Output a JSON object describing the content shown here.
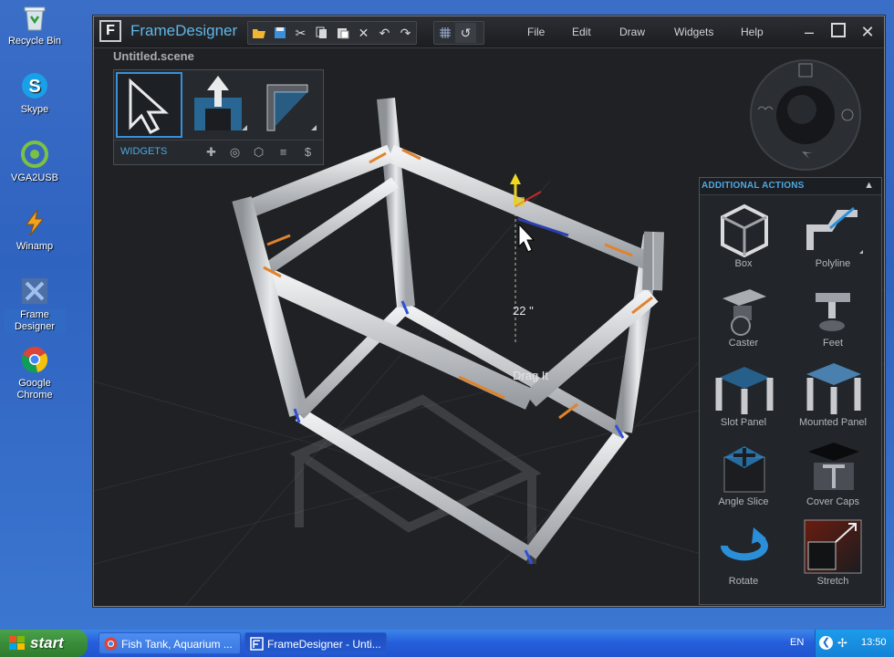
{
  "desktop": {
    "icons": [
      {
        "label": "Recycle Bin"
      },
      {
        "label": "Skype"
      },
      {
        "label": "VGA2USB"
      },
      {
        "label": "Winamp"
      },
      {
        "label": "Frame Designer"
      },
      {
        "label": "Google Chrome"
      }
    ]
  },
  "app": {
    "title": "FrameDesigner",
    "logo_letter": "F",
    "scene_name": "Untitled.scene",
    "menu": [
      "File",
      "Edit",
      "Draw",
      "Widgets",
      "Help"
    ],
    "toolbar_icons": [
      "folder-open-icon",
      "save-icon",
      "cut-icon",
      "copy-icon",
      "paste-icon",
      "delete-icon",
      "undo-icon",
      "redo-icon",
      "grid-icon",
      "snap-magnet-icon"
    ],
    "widgets_panel": {
      "label": "WIDGETS",
      "tools": [
        "select-tool",
        "extrude-tool",
        "profile-tool"
      ],
      "footer_icons": [
        "move-icon",
        "rotate-icon",
        "cube-icon",
        "list-icon",
        "price-icon"
      ],
      "price_symbol": "$"
    },
    "viewport": {
      "dimension_label": "22 \"",
      "drag_label": "Drag It"
    },
    "additional_actions": {
      "title": "ADDITIONAL ACTIONS",
      "items": [
        {
          "label": "Box"
        },
        {
          "label": "Polyline"
        },
        {
          "label": "Caster"
        },
        {
          "label": "Feet"
        },
        {
          "label": "Slot Panel"
        },
        {
          "label": "Mounted Panel"
        },
        {
          "label": "Angle Slice"
        },
        {
          "label": "Cover Caps"
        },
        {
          "label": "Rotate"
        },
        {
          "label": "Stretch"
        }
      ]
    },
    "colors": {
      "accent": "#4fa8e0",
      "highlight_orange": "#e0832a",
      "background": "#1f2124"
    }
  },
  "taskbar": {
    "start_label": "start",
    "tasks": [
      {
        "label": "Fish Tank, Aquarium ..."
      },
      {
        "label": "FrameDesigner - Unti..."
      }
    ],
    "language": "EN",
    "clock": "13:50"
  }
}
